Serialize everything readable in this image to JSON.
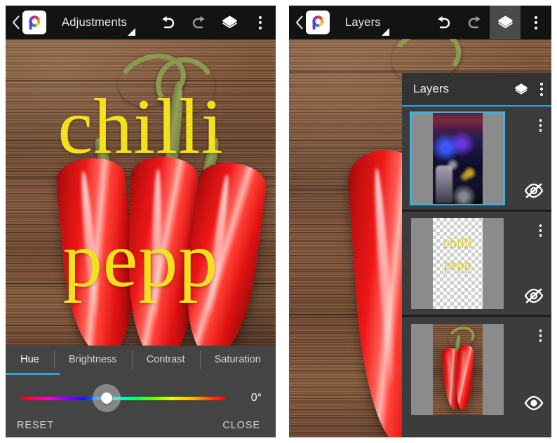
{
  "app": {
    "name": "PicsArt",
    "logo_icon": "picsart-logo-icon"
  },
  "left_panel": {
    "toolbar": {
      "back_icon": "chevron-left-icon",
      "title": "Adjustments",
      "dropdown_icon": "dropdown-caret-icon",
      "undo_icon": "undo-icon",
      "redo_icon": "redo-icon",
      "layers_icon": "layers-icon",
      "overflow_icon": "more-vertical-icon"
    },
    "canvas": {
      "text_line_1": "chilli",
      "text_line_2": "pepp",
      "text_color": "#f4e11e",
      "image_subject": "red chilli peppers on wooden board"
    },
    "dock": {
      "tabs": [
        {
          "label": "Hue",
          "active": true
        },
        {
          "label": "Brightness",
          "active": false
        },
        {
          "label": "Contrast",
          "active": false
        },
        {
          "label": "Saturation",
          "active": false
        }
      ],
      "active_tab_color": "#2ea3de",
      "slider": {
        "name": "hue-slider",
        "value": "0°",
        "position_percent": 42,
        "gradient": "hue-spectrum"
      },
      "reset_label": "RESET",
      "close_label": "CLOSE"
    }
  },
  "right_panel": {
    "toolbar": {
      "back_icon": "chevron-left-icon",
      "title": "Layers",
      "dropdown_icon": "dropdown-caret-icon",
      "undo_icon": "undo-icon",
      "redo_icon": "redo-icon",
      "layers_icon": "layers-icon",
      "layers_active": true,
      "overflow_icon": "more-vertical-icon"
    },
    "canvas": {
      "image_subject": "red chilli peppers on wooden board"
    },
    "layers_panel": {
      "title": "Layers",
      "header_icon": "layers-icon",
      "header_overflow_icon": "more-vertical-icon",
      "accent_color": "#2ea3de",
      "selected_border_color": "#33b5e5",
      "layers": [
        {
          "name": "layer-1",
          "thumbnail": "nightclub-photo",
          "selected": true,
          "visible": false,
          "visibility_icon": "eye-off-icon",
          "menu_icon": "more-vertical-icon"
        },
        {
          "name": "layer-2",
          "thumbnail": "text-layer-transparent",
          "text_line_1": "chilli",
          "text_line_2": "pepp",
          "selected": false,
          "visible": false,
          "visibility_icon": "eye-off-icon",
          "menu_icon": "more-vertical-icon"
        },
        {
          "name": "layer-3",
          "thumbnail": "chilli-peppers-photo",
          "selected": false,
          "visible": true,
          "visibility_icon": "eye-icon",
          "menu_icon": "more-vertical-icon"
        }
      ]
    }
  }
}
